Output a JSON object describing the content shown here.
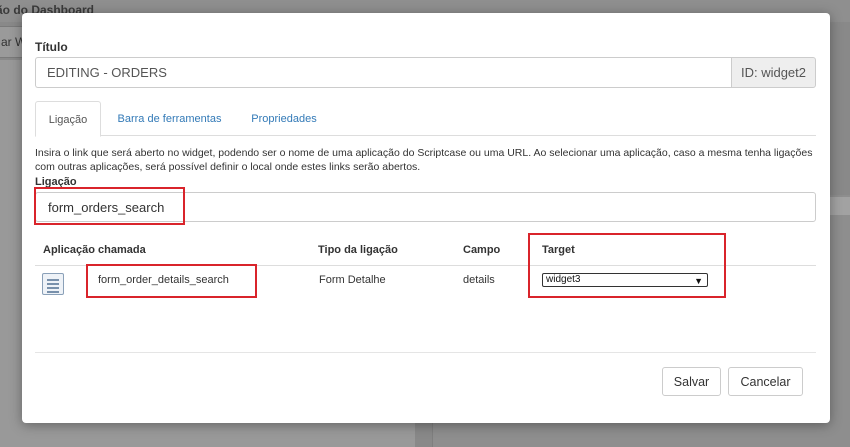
{
  "background": {
    "title": "ão do Dashboard",
    "button_label": "ar W"
  },
  "modal": {
    "title_label": "Título",
    "title_value": "EDITING - ORDERS",
    "id_text": "ID: widget2",
    "tabs": [
      {
        "label": "Ligação",
        "active": true
      },
      {
        "label": "Barra de ferramentas",
        "active": false
      },
      {
        "label": "Propriedades",
        "active": false
      }
    ],
    "help_text": "Insira o link que será aberto no widget, podendo ser o nome de uma aplicação do Scriptcase ou uma URL. Ao selecionar uma aplicação, caso a mesma tenha ligações com outras aplicações, será possível definir o local onde estes links serão abertos.",
    "link_label": "Ligação",
    "link_value": "form_orders_search",
    "table": {
      "headers": [
        "Aplicação chamada",
        "Tipo da ligação",
        "Campo",
        "Target"
      ],
      "rows": [
        {
          "app": "form_order_details_search",
          "type": "Form Detalhe",
          "field": "details",
          "target": "widget3"
        }
      ]
    },
    "buttons": {
      "save": "Salvar",
      "cancel": "Cancelar"
    }
  },
  "colors": {
    "highlight": "#d9242b",
    "link": "#337ab7",
    "overlay": "#898989"
  },
  "icons": {
    "app": "document-lines-icon",
    "select_caret": "chevron-down-icon"
  }
}
